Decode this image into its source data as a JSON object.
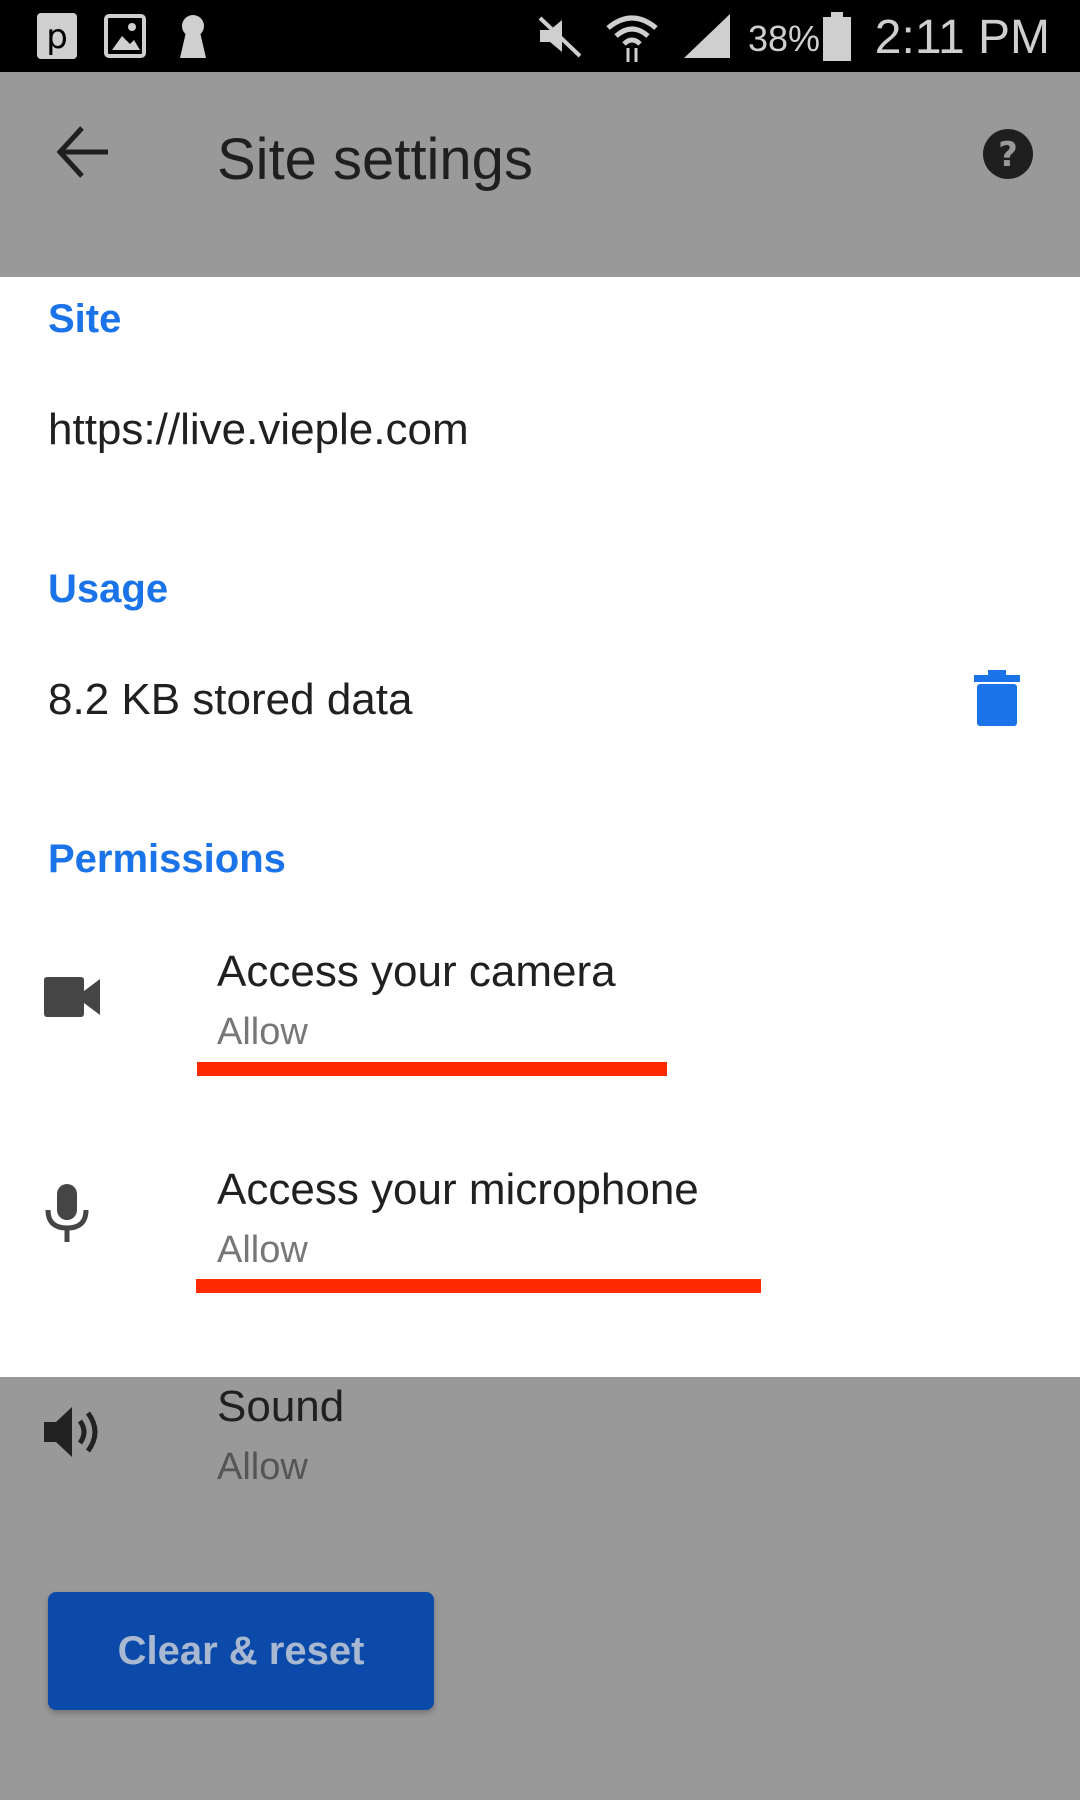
{
  "status_bar": {
    "battery_percent": "38%",
    "time": "2:11 PM",
    "icons": [
      "p-app-icon",
      "image-icon",
      "keyhole-icon",
      "mute-icon",
      "wifi-icon",
      "signal-icon",
      "battery-icon"
    ]
  },
  "app_bar": {
    "title": "Site settings",
    "back_icon": "arrow-back-icon",
    "help_icon": "help-icon"
  },
  "site": {
    "header": "Site",
    "url": "https://live.vieple.com"
  },
  "usage": {
    "header": "Usage",
    "stored_data": "8.2 KB stored data",
    "delete_icon": "trash-icon"
  },
  "permissions": {
    "header": "Permissions",
    "items": [
      {
        "title": "Access your camera",
        "value": "Allow",
        "icon": "camera-icon"
      },
      {
        "title": "Access your microphone",
        "value": "Allow",
        "icon": "microphone-icon"
      },
      {
        "title": "Sound",
        "value": "Allow",
        "icon": "speaker-icon"
      }
    ]
  },
  "actions": {
    "reset_label": "Clear & reset"
  },
  "colors": {
    "accent": "#1a73e8",
    "button": "#0b4aa8",
    "annotation": "#ff2a00",
    "overlay": "#999999"
  }
}
